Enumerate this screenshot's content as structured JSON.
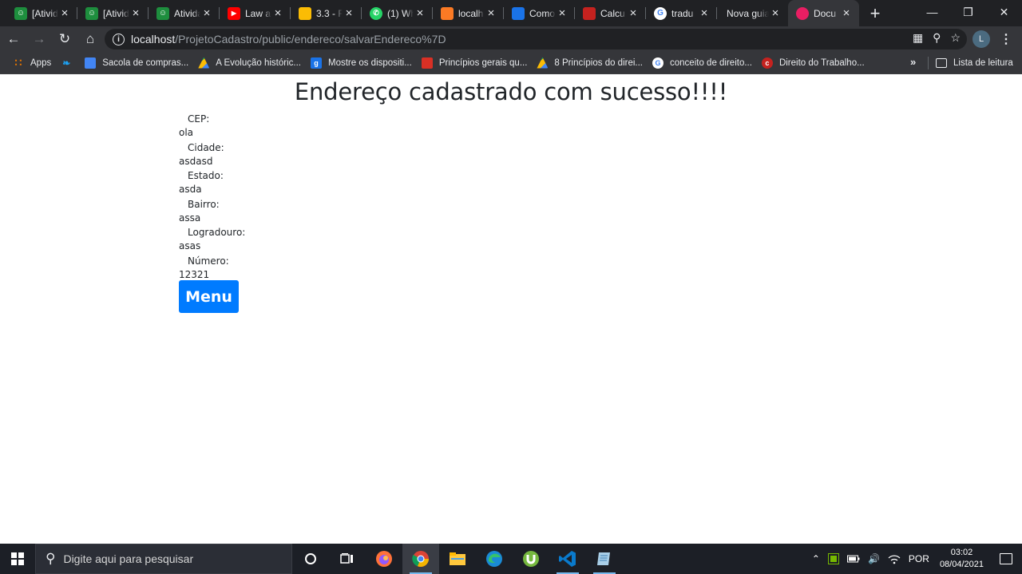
{
  "browser": {
    "tabs": [
      {
        "title": "[Ativid",
        "icon": "classroom-icon",
        "color": "#1e8e3e"
      },
      {
        "title": "[Ativid",
        "icon": "classroom-icon",
        "color": "#1e8e3e"
      },
      {
        "title": "Ativida",
        "icon": "classroom-icon",
        "color": "#1e8e3e"
      },
      {
        "title": "Law an",
        "icon": "youtube-icon",
        "color": "#ff0000"
      },
      {
        "title": "3.3 - F",
        "icon": "drive-icon",
        "color": "#fbbc04"
      },
      {
        "title": "(1) Wh",
        "icon": "whatsapp-icon",
        "color": "#25d366"
      },
      {
        "title": "localh",
        "icon": "xampp-icon",
        "color": "#fb7a24"
      },
      {
        "title": "Como",
        "icon": "box-icon",
        "color": "#1a73e8"
      },
      {
        "title": "Calcu",
        "icon": "calculator-icon",
        "color": "#c5221f"
      },
      {
        "title": "tradu",
        "icon": "google-icon",
        "color": "#ffffff"
      },
      {
        "title": "Nova guia",
        "icon": "",
        "color": ""
      },
      {
        "title": "Docu",
        "icon": "document-icon",
        "color": "#e91e63"
      }
    ],
    "active_tab_index": 11,
    "new_tab_label": "+",
    "url_host": "localhost",
    "url_path": "/ProjetoCadastro/public/endereco/salvarEndereco%7D",
    "profile_initial": "L",
    "bookmarks": [
      {
        "label": "Apps",
        "icon": "apps-grid-icon",
        "color": "#e37400"
      },
      {
        "label": "",
        "icon": "twitter-icon",
        "color": "#1da1f2"
      },
      {
        "label": "Sacola de compras...",
        "icon": "shopping-bag-icon",
        "color": "#4285f4"
      },
      {
        "label": "A Evolução históric...",
        "icon": "drive-icon",
        "color": "#fbbc04"
      },
      {
        "label": "Mostre os dispositi...",
        "icon": "g-icon",
        "color": "#1a73e8"
      },
      {
        "label": "Princípios gerais qu...",
        "icon": "bookmark-red-icon",
        "color": "#d93025"
      },
      {
        "label": "8 Princípios do direi...",
        "icon": "drive-icon",
        "color": "#fbbc04"
      },
      {
        "label": "conceito de direito...",
        "icon": "google-icon",
        "color": "#ffffff"
      },
      {
        "label": "Direito do Trabalho...",
        "icon": "c-red-icon",
        "color": "#c5221f"
      }
    ],
    "bookmarks_overflow": "»",
    "reading_list_label": "Lista de leitura"
  },
  "page": {
    "title": "Endereço cadastrado com sucesso!!!!",
    "fields": [
      {
        "label": "CEP:",
        "value": "ola"
      },
      {
        "label": "Cidade:",
        "value": "asdasd"
      },
      {
        "label": "Estado:",
        "value": "asda"
      },
      {
        "label": "Bairro:",
        "value": "assa"
      },
      {
        "label": "Logradouro:",
        "value": "asas"
      },
      {
        "label": "Número:",
        "value": "12321"
      }
    ],
    "menu_button_label": "Menu",
    "accent_color": "#007bff"
  },
  "taskbar": {
    "search_placeholder": "Digite aqui para pesquisar",
    "apps": [
      {
        "name": "task-view-icon"
      },
      {
        "name": "cortana-icon"
      },
      {
        "name": "firefox-icon"
      },
      {
        "name": "chrome-icon"
      },
      {
        "name": "file-explorer-icon"
      },
      {
        "name": "edge-icon"
      },
      {
        "name": "utorrent-icon"
      },
      {
        "name": "vscode-icon"
      },
      {
        "name": "notepad-icon"
      }
    ],
    "language": "POR",
    "time": "03:02",
    "date": "08/04/2021"
  }
}
